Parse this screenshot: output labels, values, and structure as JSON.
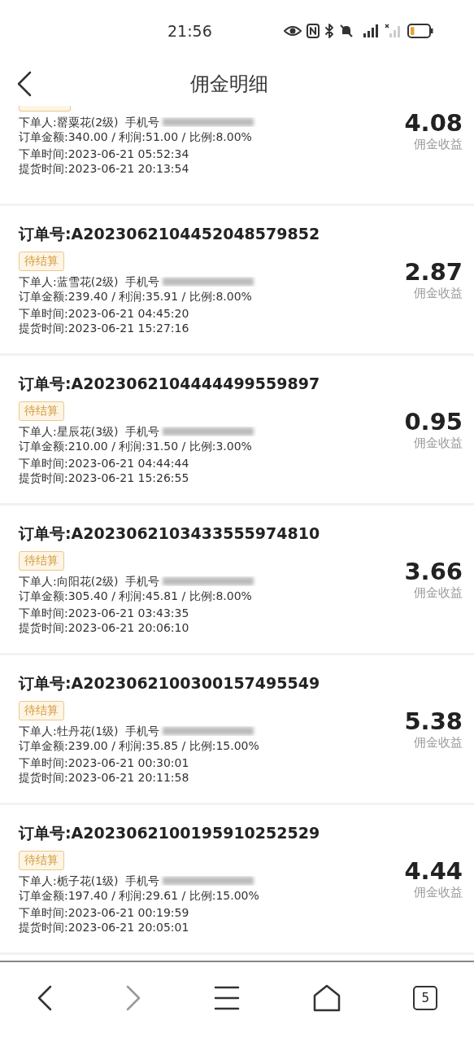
{
  "status_bar": {
    "time": "21:56"
  },
  "header": {
    "title": "佣金明细"
  },
  "orders": [
    {
      "partial": true,
      "buyer": "下单人:罂粟花(2级)",
      "phone_label": "手机号",
      "amounts": "订单金额:340.00 / 利润:51.00 / 比例:8.00%",
      "order_time": "下单时间:2023-06-21 05:52:34",
      "pickup_time": "提货时间:2023-06-21 20:13:54",
      "commission": "4.08",
      "commission_label": "佣金收益"
    },
    {
      "partial": false,
      "order_no": "订单号:A2023062104452048579852",
      "status": "待结算",
      "buyer": "下单人:蓝雪花(2级)",
      "phone_label": "手机号",
      "amounts": "订单金额:239.40 / 利润:35.91 / 比例:8.00%",
      "order_time": "下单时间:2023-06-21 04:45:20",
      "pickup_time": "提货时间:2023-06-21 15:27:16",
      "commission": "2.87",
      "commission_label": "佣金收益"
    },
    {
      "partial": false,
      "order_no": "订单号:A2023062104444499559897",
      "status": "待结算",
      "buyer": "下单人:星辰花(3级)",
      "phone_label": "手机号",
      "amounts": "订单金额:210.00 / 利润:31.50 / 比例:3.00%",
      "order_time": "下单时间:2023-06-21 04:44:44",
      "pickup_time": "提货时间:2023-06-21 15:26:55",
      "commission": "0.95",
      "commission_label": "佣金收益"
    },
    {
      "partial": false,
      "order_no": "订单号:A2023062103433555974810",
      "status": "待结算",
      "buyer": "下单人:向阳花(2级)",
      "phone_label": "手机号",
      "amounts": "订单金额:305.40 / 利润:45.81 / 比例:8.00%",
      "order_time": "下单时间:2023-06-21 03:43:35",
      "pickup_time": "提货时间:2023-06-21 20:06:10",
      "commission": "3.66",
      "commission_label": "佣金收益"
    },
    {
      "partial": false,
      "order_no": "订单号:A2023062100300157495549",
      "status": "待结算",
      "buyer": "下单人:牡丹花(1级)",
      "phone_label": "手机号",
      "amounts": "订单金额:239.00 / 利润:35.85 / 比例:15.00%",
      "order_time": "下单时间:2023-06-21 00:30:01",
      "pickup_time": "提货时间:2023-06-21 20:11:58",
      "commission": "5.38",
      "commission_label": "佣金收益"
    },
    {
      "partial": false,
      "order_no": "订单号:A2023062100195910252529",
      "status": "待结算",
      "buyer": "下单人:栀子花(1级)",
      "phone_label": "手机号",
      "amounts": "订单金额:197.40 / 利润:29.61 / 比例:15.00%",
      "order_time": "下单时间:2023-06-21 00:19:59",
      "pickup_time": "提货时间:2023-06-21 20:05:01",
      "commission": "4.44",
      "commission_label": "佣金收益"
    }
  ],
  "browser_bar": {
    "tab_count": "5"
  }
}
